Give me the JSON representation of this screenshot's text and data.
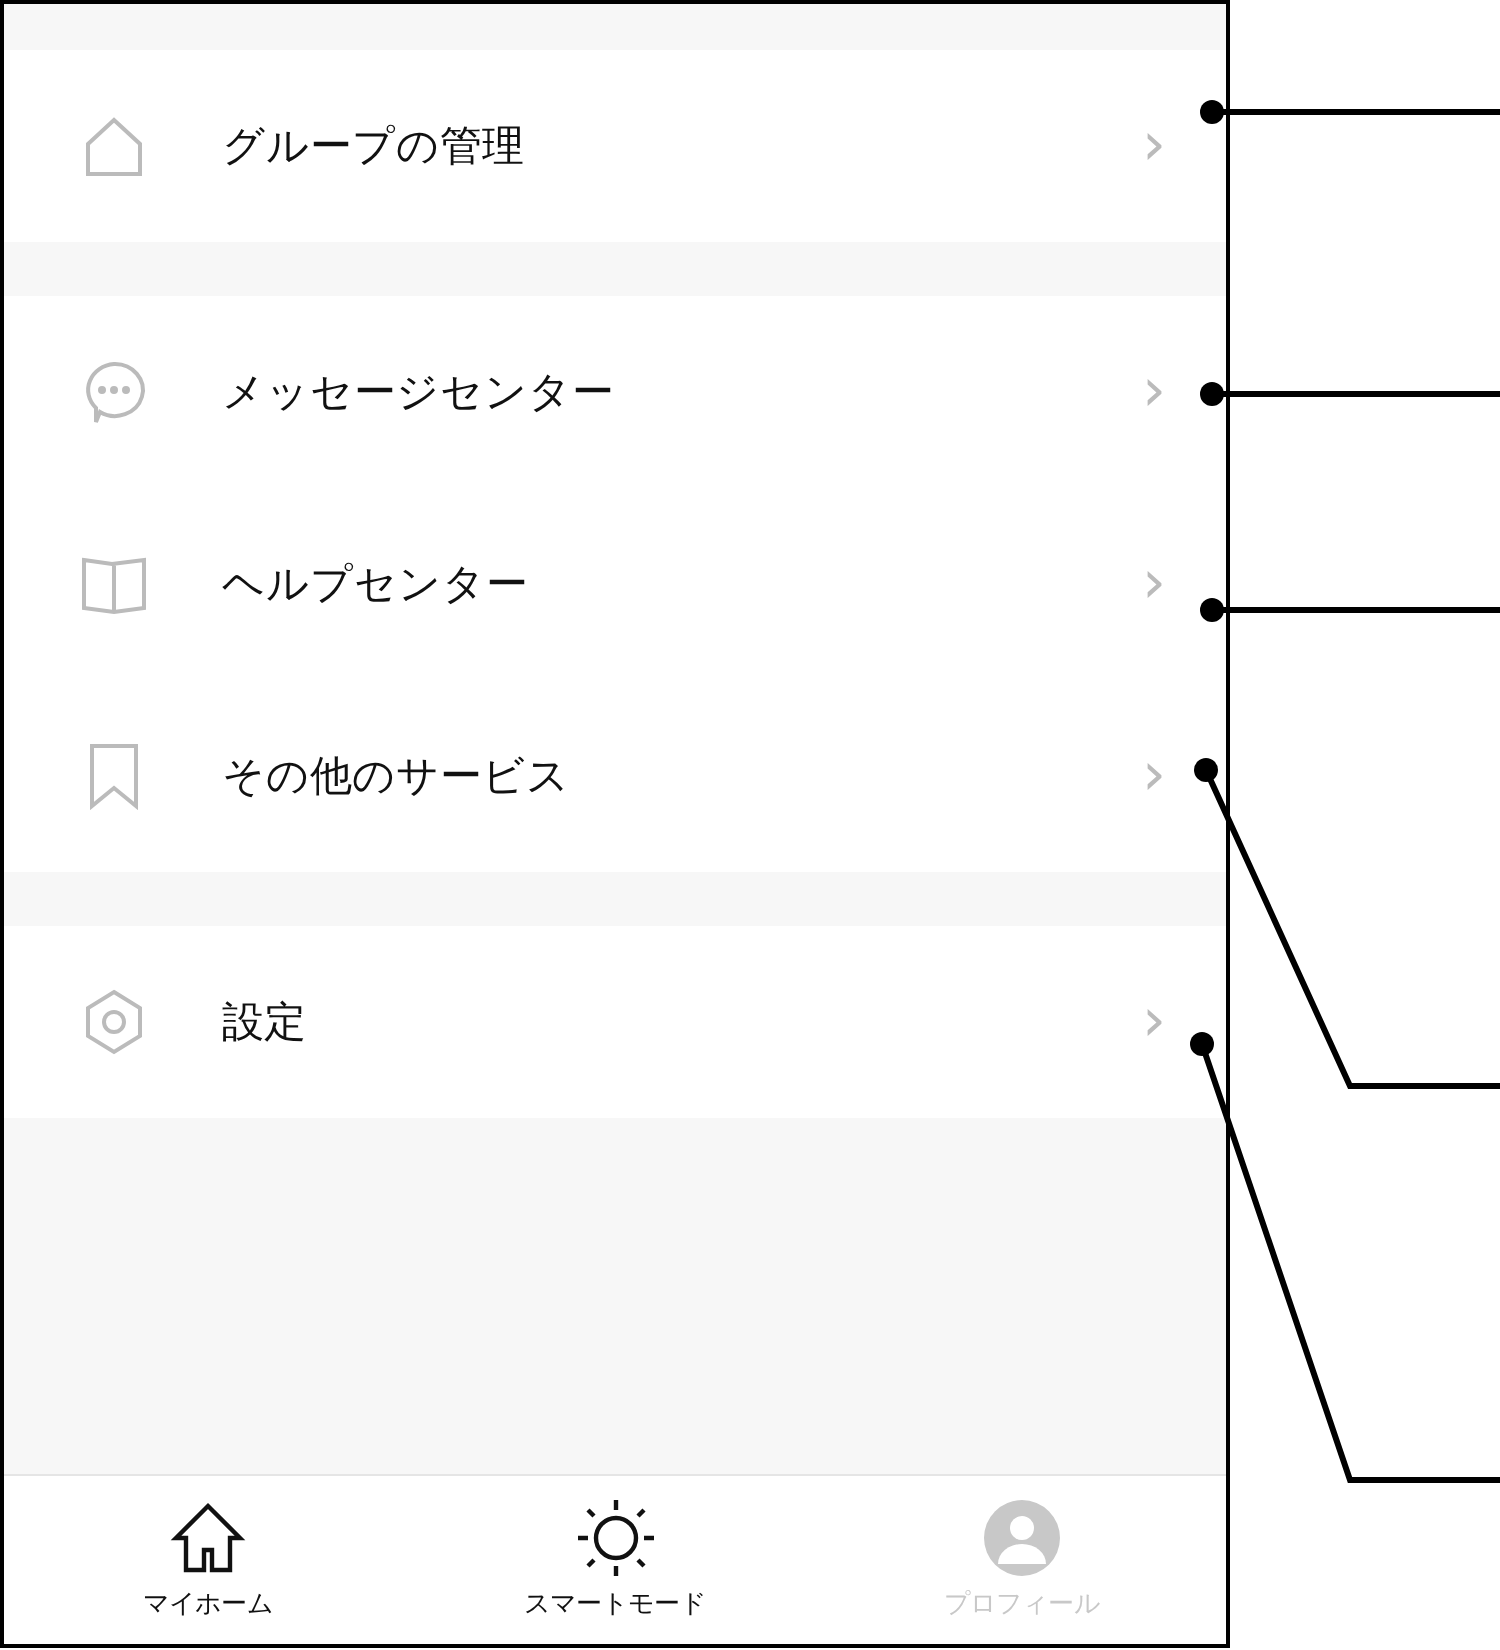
{
  "sections": [
    {
      "items": [
        {
          "kind": "house",
          "label": "グループの管理",
          "chevron": "›"
        }
      ]
    },
    {
      "items": [
        {
          "kind": "chat",
          "label": "メッセージセンター",
          "chevron": "›"
        },
        {
          "kind": "book",
          "label": "ヘルプセンター",
          "chevron": "›"
        },
        {
          "kind": "bookmark",
          "label": "その他のサービス",
          "chevron": "›"
        }
      ]
    },
    {
      "items": [
        {
          "kind": "gear",
          "label": "設定",
          "chevron": "›"
        }
      ]
    }
  ],
  "tab_bar": [
    {
      "kind": "house",
      "label": "マイホーム",
      "disabled": false
    },
    {
      "kind": "sun",
      "label": "スマートモード",
      "disabled": false
    },
    {
      "kind": "person",
      "label": "プロフィール",
      "disabled": true
    }
  ]
}
